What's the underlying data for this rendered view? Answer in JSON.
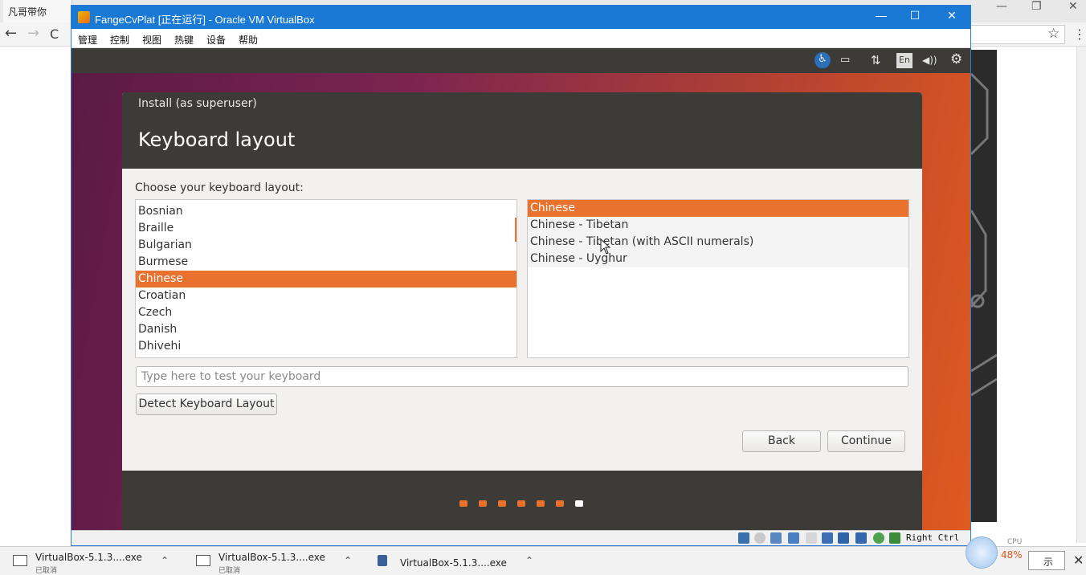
{
  "browser": {
    "tab_title": "凡哥带你",
    "nav_back": "←",
    "nav_forward": "→",
    "nav_reload": "C",
    "star": "☆",
    "menu": "⋮",
    "win_min": "—",
    "win_max": "❐",
    "win_close": "✕"
  },
  "vbox": {
    "title": "FangeCvPlat [正在运行] - Oracle VM VirtualBox",
    "min_label": "—",
    "max_label": "☐",
    "close_label": "✕",
    "menus": [
      "管理",
      "控制",
      "视图",
      "热键",
      "设备",
      "帮助"
    ],
    "host_key": "Right Ctrl"
  },
  "guest": {
    "indicators": {
      "accessibility": "♿",
      "keyboard": "▭",
      "network": "⇅",
      "lang": "En",
      "volume": "◀))",
      "settings": "⚙"
    }
  },
  "installer": {
    "window_title": "Install (as superuser)",
    "page_title": "Keyboard layout",
    "choose_label": "Choose your keyboard layout:",
    "layouts": [
      "Bosnian",
      "Braille",
      "Bulgarian",
      "Burmese",
      "Chinese",
      "Croatian",
      "Czech",
      "Danish",
      "Dhivehi"
    ],
    "selected_layout": "Chinese",
    "variants": [
      "Chinese",
      "Chinese - Tibetan",
      "Chinese - Tibetan (with ASCII numerals)",
      "Chinese - Uyghur"
    ],
    "selected_variant": "Chinese",
    "test_placeholder": "Type here to test your keyboard",
    "detect_button": "Detect Keyboard Layout",
    "back_button": "Back",
    "continue_button": "Continue",
    "progress": {
      "total_steps": 7,
      "current_step": 7
    }
  },
  "colors": {
    "accent": "#e9722f",
    "dark": "#3c3b37",
    "titlebar": "#1b79d6"
  },
  "downloads": {
    "items": [
      {
        "name": "VirtualBox-5.1.3....exe",
        "status": "已取消"
      },
      {
        "name": "VirtualBox-5.1.3....exe",
        "status": "已取消"
      },
      {
        "name": "VirtualBox-5.1.3....exe",
        "status": ""
      }
    ],
    "show_all": "示",
    "close": "✕"
  },
  "cpu": {
    "label": "CPU",
    "value": "48%"
  }
}
